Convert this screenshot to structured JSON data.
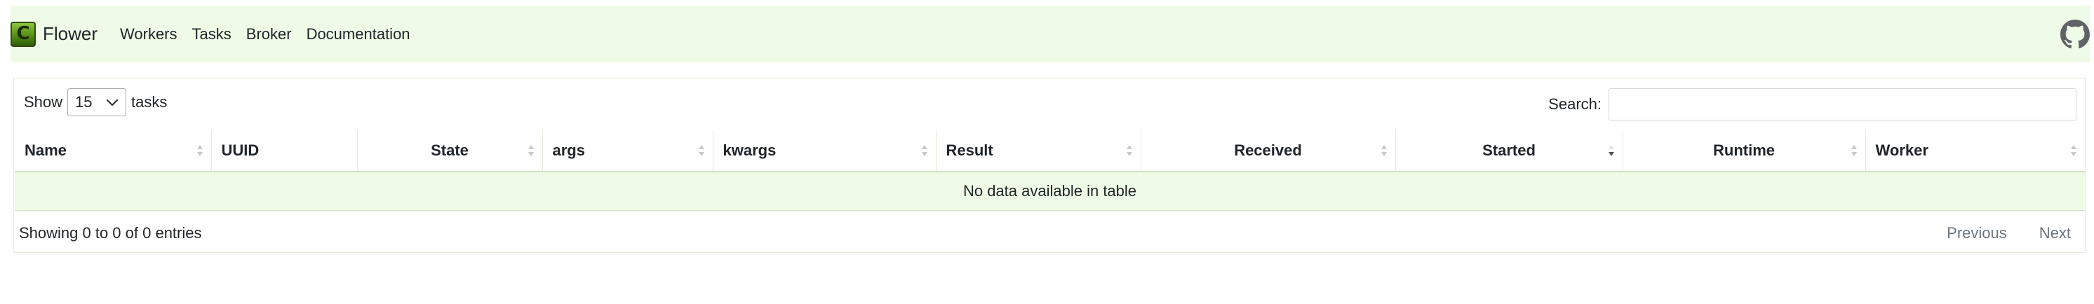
{
  "navbar": {
    "brand_letter": "C",
    "brand_name": "Flower",
    "links": [
      "Workers",
      "Tasks",
      "Broker",
      "Documentation"
    ]
  },
  "controls": {
    "show_label": "Show",
    "page_length": "15",
    "length_suffix": "tasks",
    "search_label": "Search:",
    "search_value": "",
    "search_placeholder": ""
  },
  "table": {
    "columns": [
      "Name",
      "UUID",
      "State",
      "args",
      "kwargs",
      "Result",
      "Received",
      "Started",
      "Runtime",
      "Worker"
    ],
    "sorted_column": "Started",
    "sort_direction": "desc",
    "empty_message": "No data available in table"
  },
  "footer": {
    "info": "Showing 0 to 0 of 0 entries",
    "previous": "Previous",
    "next": "Next"
  },
  "colors": {
    "navbar_bg": "#eefbe6",
    "row_bg": "#eefbe6",
    "muted": "#6c757d"
  }
}
